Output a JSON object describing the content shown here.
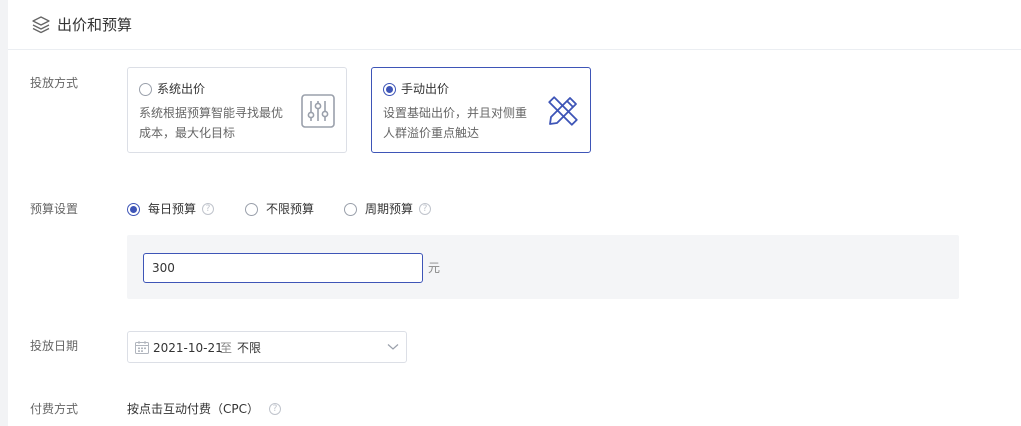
{
  "section": {
    "title": "出价和预算",
    "icon": "layers-icon"
  },
  "bid_method": {
    "label": "投放方式",
    "options": [
      {
        "title": "系统出价",
        "desc": "系统根据预算智能寻找最优成本，最大化目标",
        "selected": false,
        "icon": "sliders-icon"
      },
      {
        "title": "手动出价",
        "desc": "设置基础出价，并且对侧重人群溢价重点触达",
        "selected": true,
        "icon": "pencil-ruler-icon"
      }
    ]
  },
  "budget": {
    "label": "预算设置",
    "options": [
      {
        "label": "每日预算",
        "selected": true,
        "help": true
      },
      {
        "label": "不限预算",
        "selected": false,
        "help": false
      },
      {
        "label": "周期预算",
        "selected": false,
        "help": true
      }
    ],
    "value": "300",
    "unit": "元"
  },
  "date": {
    "label": "投放日期",
    "start": "2021-10-21",
    "separator": "至",
    "end": "不限"
  },
  "payment": {
    "label": "付费方式",
    "value": "按点击互动付费（CPC）"
  },
  "colors": {
    "accent": "#3e55b7",
    "border": "#dcdfe6",
    "muted": "#666666"
  }
}
